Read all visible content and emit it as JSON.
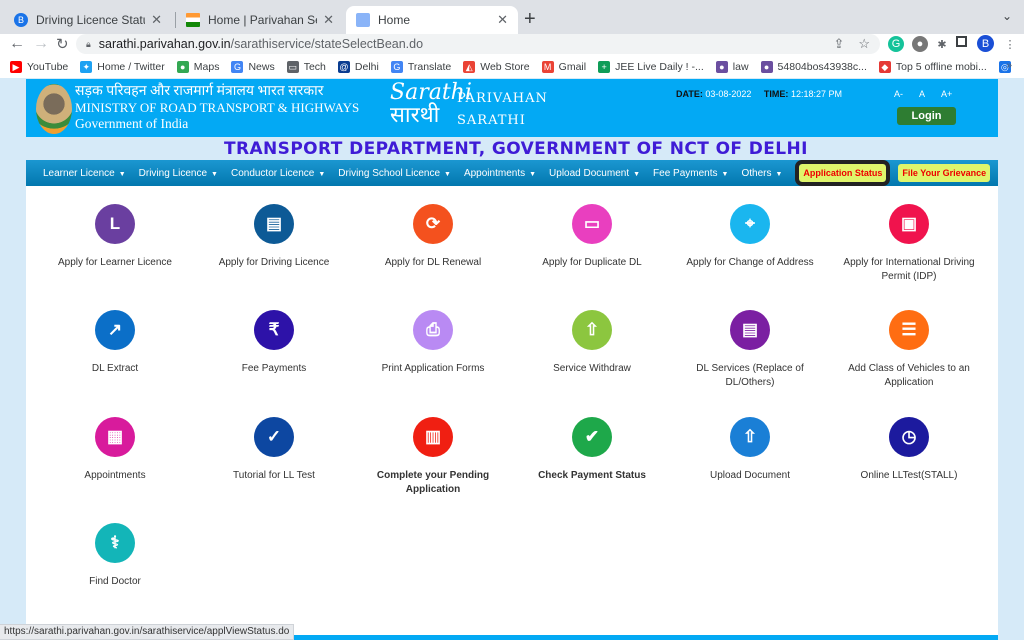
{
  "browser": {
    "tabs": [
      {
        "title": "Driving Licence Status Online |",
        "favicon": "B",
        "color": "#1a73e8",
        "active": false
      },
      {
        "title": "Home | Parivahan Sewa | Minis",
        "favicon": "flag",
        "color": "#ff9933",
        "active": false
      },
      {
        "title": "Home",
        "favicon": "building",
        "color": "#8ab4f8",
        "active": true
      }
    ],
    "url_host": "sarathi.parivahan.gov.in",
    "url_path": "/sarathiservice/stateSelectBean.do",
    "bookmarks": [
      {
        "label": "YouTube",
        "icon": "youtube-icon",
        "color": "#ff0000",
        "glyph": "▶"
      },
      {
        "label": "Home / Twitter",
        "icon": "twitter-icon",
        "color": "#1da1f2",
        "glyph": "✦"
      },
      {
        "label": "Maps",
        "icon": "maps-icon",
        "color": "#34a853",
        "glyph": "●"
      },
      {
        "label": "News",
        "icon": "news-icon",
        "color": "#4285f4",
        "glyph": "G"
      },
      {
        "label": "Tech",
        "icon": "folder-icon",
        "color": "#5f6368",
        "glyph": "▭"
      },
      {
        "label": "Delhi",
        "icon": "delhi-icon",
        "color": "#0b3d91",
        "glyph": "@"
      },
      {
        "label": "Translate",
        "icon": "translate-icon",
        "color": "#4285f4",
        "glyph": "G"
      },
      {
        "label": "Web Store",
        "icon": "webstore-icon",
        "color": "#ea4335",
        "glyph": "◭"
      },
      {
        "label": "Gmail",
        "icon": "gmail-icon",
        "color": "#ea4335",
        "glyph": "M"
      },
      {
        "label": "JEE Live Daily ! -...",
        "icon": "sheet-icon",
        "color": "#0f9d58",
        "glyph": "+"
      },
      {
        "label": "law",
        "icon": "emblem-icon",
        "color": "#6b4fa0",
        "glyph": "●"
      },
      {
        "label": "54804bos43938c...",
        "icon": "emblem-icon",
        "color": "#6b4fa0",
        "glyph": "●"
      },
      {
        "label": "Top 5 offline mobi...",
        "icon": "diamond-icon",
        "color": "#e53935",
        "glyph": "◆"
      },
      {
        "label": "",
        "icon": "owl-icon",
        "color": "#1a73e8",
        "glyph": "◎"
      }
    ],
    "bookmarks_more": "»",
    "status_url": "https://sarathi.parivahan.gov.in/sarathiservice/applViewStatus.do"
  },
  "header": {
    "ministry_hindi": "सड़क परिवहन और राजमार्ग मंत्रालय भारत सरकार",
    "ministry_english": "MINISTRY OF ROAD TRANSPORT & HIGHWAYS",
    "government": "Government of India",
    "logo_script_en": "Sarathi",
    "logo_script_hi": "सारथी",
    "logo_parivahan": "PARIVAHAN",
    "logo_sarathi": "SARATHI",
    "date_label": "DATE:",
    "date_value": "03-08-2022",
    "time_label": "TIME:",
    "time_value": "12:18:27 PM",
    "font_small": "A-",
    "font_normal": "A",
    "font_large": "A+",
    "login_label": "Login"
  },
  "department_title": "TRANSPORT DEPARTMENT, GOVERNMENT OF NCT OF DELHI",
  "menu": {
    "items": [
      "Learner Licence",
      "Driving Licence",
      "Conductor Licence",
      "Driving School Licence",
      "Appointments",
      "Upload Document",
      "Fee Payments",
      "Others"
    ],
    "caret": "▼",
    "application_status": "Application Status",
    "file_grievance": "File Your Grievance"
  },
  "services": [
    {
      "label": "Apply for Learner Licence",
      "icon": "learner-licence-icon",
      "color": "#6a3fa0",
      "glyph": "L",
      "bold": false
    },
    {
      "label": "Apply for Driving Licence",
      "icon": "driving-licence-icon",
      "color": "#0d5a96",
      "glyph": "▤",
      "bold": false
    },
    {
      "label": "Apply for DL Renewal",
      "icon": "dl-renewal-icon",
      "color": "#f4511e",
      "glyph": "⟳",
      "bold": false
    },
    {
      "label": "Apply for Duplicate DL",
      "icon": "duplicate-dl-icon",
      "color": "#e93fbf",
      "glyph": "▭",
      "bold": false
    },
    {
      "label": "Apply for Change of Address",
      "icon": "location-pin-icon",
      "color": "#1ab6ef",
      "glyph": "⌖",
      "bold": false
    },
    {
      "label": "Apply for International Driving Permit (IDP)",
      "icon": "id-card-icon",
      "color": "#f0134d",
      "glyph": "▣",
      "bold": false
    },
    {
      "label": "DL Extract",
      "icon": "export-icon",
      "color": "#0b6fc8",
      "glyph": "↗",
      "bold": false
    },
    {
      "label": "Fee Payments",
      "icon": "hand-payment-icon",
      "color": "#2d12a8",
      "glyph": "₹",
      "bold": false
    },
    {
      "label": "Print Application Forms",
      "icon": "printer-icon",
      "color": "#b98af3",
      "glyph": "⎙",
      "bold": false
    },
    {
      "label": "Service Withdraw",
      "icon": "withdraw-upload-icon",
      "color": "#8cc63f",
      "glyph": "⇧",
      "bold": false
    },
    {
      "label": "DL Services (Replace of DL/Others)",
      "icon": "dl-card-icon",
      "color": "#7b1fa2",
      "glyph": "▤",
      "bold": false
    },
    {
      "label": "Add Class of Vehicles to an Application",
      "icon": "checklist-icon",
      "color": "#ff6d12",
      "glyph": "☰",
      "bold": false
    },
    {
      "label": "Appointments",
      "icon": "calendar-icon",
      "color": "#d81b9c",
      "glyph": "▦",
      "bold": false
    },
    {
      "label": "Tutorial for LL Test",
      "icon": "clipboard-check-icon",
      "color": "#0d47a1",
      "glyph": "✓",
      "bold": false
    },
    {
      "label": "Complete your Pending Application",
      "icon": "report-clipboard-icon",
      "color": "#f01f12",
      "glyph": "▥",
      "bold": true
    },
    {
      "label": "Check Payment Status",
      "icon": "card-check-icon",
      "color": "#1ea84a",
      "glyph": "✔",
      "bold": true
    },
    {
      "label": "Upload Document",
      "icon": "upload-icon",
      "color": "#1a7fd6",
      "glyph": "⇧",
      "bold": false
    },
    {
      "label": "Online LLTest(STALL)",
      "icon": "online-test-icon",
      "color": "#1c1a9e",
      "glyph": "◷",
      "bold": false
    },
    {
      "label": "Find Doctor",
      "icon": "doctor-icon",
      "color": "#13b5b8",
      "glyph": "⚕",
      "bold": false
    }
  ]
}
